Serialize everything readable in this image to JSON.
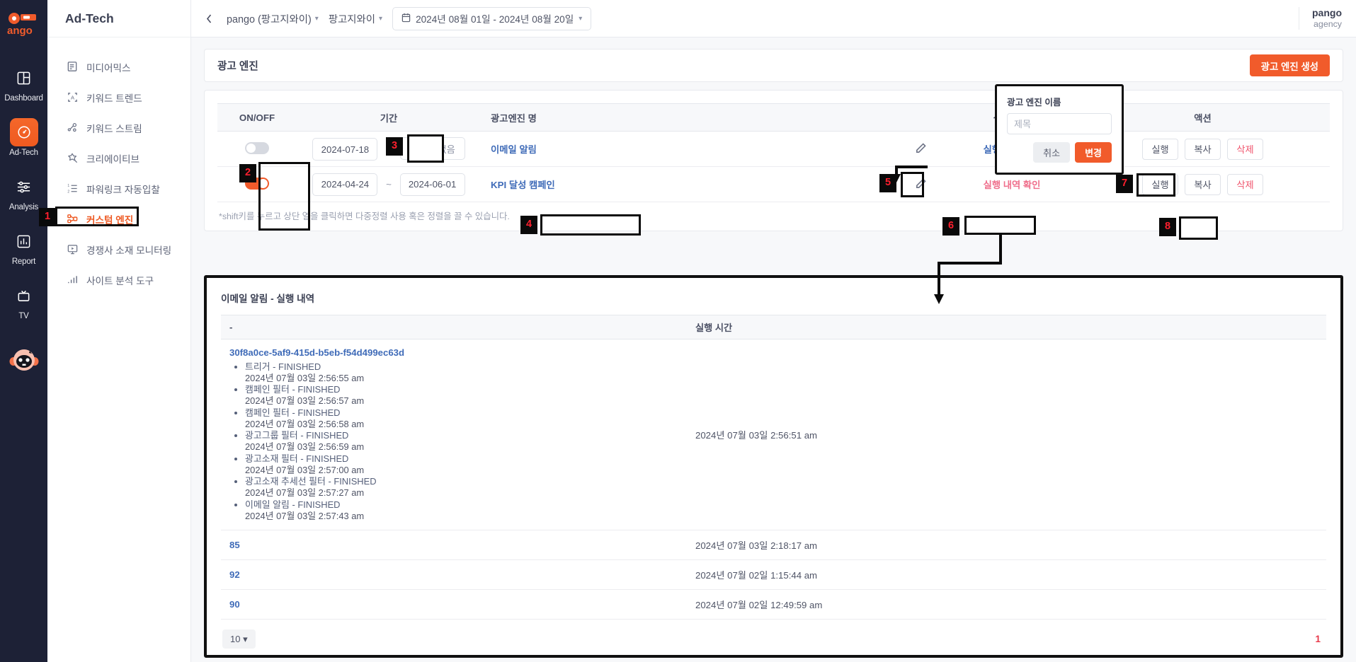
{
  "rail": {
    "logo": "pango-logo",
    "items": [
      {
        "label": "Dashboard",
        "icon": "dashboard-icon",
        "active": false
      },
      {
        "label": "Ad-Tech",
        "icon": "adtech-gauge-icon",
        "active": true
      },
      {
        "label": "Analysis",
        "icon": "sliders-icon",
        "active": false
      },
      {
        "label": "Report",
        "icon": "bar-chart-icon",
        "active": false
      },
      {
        "label": "TV",
        "icon": "tv-icon",
        "active": false
      }
    ],
    "mascot": "pango-mascot-icon"
  },
  "subnav": {
    "title": "Ad-Tech",
    "items": [
      {
        "label": "미디어믹스",
        "icon": "document-list-icon",
        "active": false
      },
      {
        "label": "키워드 트렌드",
        "icon": "keyword-a-icon",
        "active": false
      },
      {
        "label": "키워드 스트림",
        "icon": "stream-nodes-icon",
        "active": false
      },
      {
        "label": "크리에이티브",
        "icon": "sparkle-star-icon",
        "active": false
      },
      {
        "label": "파워링크 자동입찰",
        "icon": "ordered-list-icon",
        "active": false
      },
      {
        "label": "커스텀 엔진",
        "icon": "engine-nodes-icon",
        "active": true
      },
      {
        "label": "경쟁사 소재 모니터링",
        "icon": "monitor-play-icon",
        "active": false
      },
      {
        "label": "사이트 분석 도구",
        "icon": "analytics-bars-icon",
        "active": false
      }
    ]
  },
  "topbar": {
    "collapse_icon": "chevron-left-icon",
    "breadcrumbs": [
      {
        "label": "pango (팡고지와이)",
        "icon": "chevron-down-icon"
      },
      {
        "label": "팡고지와이",
        "icon": "chevron-down-icon"
      }
    ],
    "date_range": {
      "icon": "calendar-icon",
      "value": "2024년 08월 01일 - 2024년 08월 20일",
      "caret": "chevron-down-icon"
    },
    "account": {
      "name": "pango",
      "role": "agency"
    }
  },
  "card": {
    "title": "광고 엔진",
    "create_button": "광고 엔진 생성"
  },
  "table": {
    "headers": [
      "ON/OFF",
      "기간",
      "광고엔진 명",
      "",
      "실행 내역",
      "액션"
    ],
    "rows": [
      {
        "toggle_on": false,
        "start_date": "2024-07-18",
        "tilde": "~",
        "end_date": "종료일 없음",
        "end_date_muted": true,
        "name": "이메일 알림",
        "edit_icon": "pencil-icon",
        "history_label": "실행 내역 확인",
        "history_highlight": false,
        "actions": [
          "실행",
          "복사",
          "삭제"
        ]
      },
      {
        "toggle_on": true,
        "start_date": "2024-04-24",
        "tilde": "~",
        "end_date": "2024-06-01",
        "end_date_muted": false,
        "name": "KPI 달성 캠페인",
        "edit_icon": "pencil-icon",
        "history_label": "실행 내역 확인",
        "history_highlight": true,
        "actions": [
          "실행",
          "복사",
          "삭제"
        ]
      }
    ],
    "hint": "*shift키를 누르고 상단 열을 클릭하면 다중정렬 사용 혹은 정렬을 끌 수 있습니다."
  },
  "rename_popup": {
    "label": "광고 엔진 이름",
    "input_value": "",
    "input_placeholder": "제목",
    "cancel_label": "취소",
    "confirm_label": "변경"
  },
  "detail": {
    "title": "이메일 알림 - 실행 내역",
    "headers": [
      "-",
      "실행 시간"
    ],
    "rows": [
      {
        "id": "30f8a0ce-5af9-415d-b5eb-f54d499ec63d",
        "steps": [
          {
            "name": "트리거 - FINISHED",
            "time": "2024년 07월 03일 2:56:55 am"
          },
          {
            "name": "캠페인 필터 - FINISHED",
            "time": "2024년 07월 03일 2:56:57 am"
          },
          {
            "name": "캠페인 필터 - FINISHED",
            "time": "2024년 07월 03일 2:56:58 am"
          },
          {
            "name": "광고그룹 필터 - FINISHED",
            "time": "2024년 07월 03일 2:56:59 am"
          },
          {
            "name": "광고소재 필터 - FINISHED",
            "time": "2024년 07월 03일 2:57:00 am"
          },
          {
            "name": "광고소재 추세선 필터 - FINISHED",
            "time": "2024년 07월 03일 2:57:27 am"
          },
          {
            "name": "이메일 알림 - FINISHED",
            "time": "2024년 07월 03일 2:57:43 am"
          }
        ],
        "run_time": "2024년 07월 03일 2:56:51 am"
      },
      {
        "id": "85",
        "steps": [],
        "run_time": "2024년 07월 03일 2:18:17 am"
      },
      {
        "id": "92",
        "steps": [],
        "run_time": "2024년 07월 02일 1:15:44 am"
      },
      {
        "id": "90",
        "steps": [],
        "run_time": "2024년 07월 02일 12:49:59 am"
      }
    ],
    "page_size": "10",
    "page_size_caret": "caret-down-icon",
    "current_page": "1"
  },
  "annotations": {
    "markers": [
      {
        "id": "1",
        "target": "sidebar-item-custom-engine"
      },
      {
        "id": "2",
        "target": "toggle-column"
      },
      {
        "id": "3",
        "target": "period-column-header"
      },
      {
        "id": "4",
        "target": "engine-name-kpi"
      },
      {
        "id": "5",
        "target": "edit-pencil-row1"
      },
      {
        "id": "6",
        "target": "history-link-row2"
      },
      {
        "id": "7",
        "target": "run-button-row1"
      },
      {
        "id": "8",
        "target": "copy-button-row2"
      }
    ]
  },
  "colors": {
    "accent": "#f15b2b",
    "rail_bg": "#1d2136",
    "link": "#3f6bb8",
    "danger": "#f0556d",
    "annotation": "#0a0a0a",
    "annotation_text": "#ff1f2e",
    "page_active": "#e8394a"
  }
}
